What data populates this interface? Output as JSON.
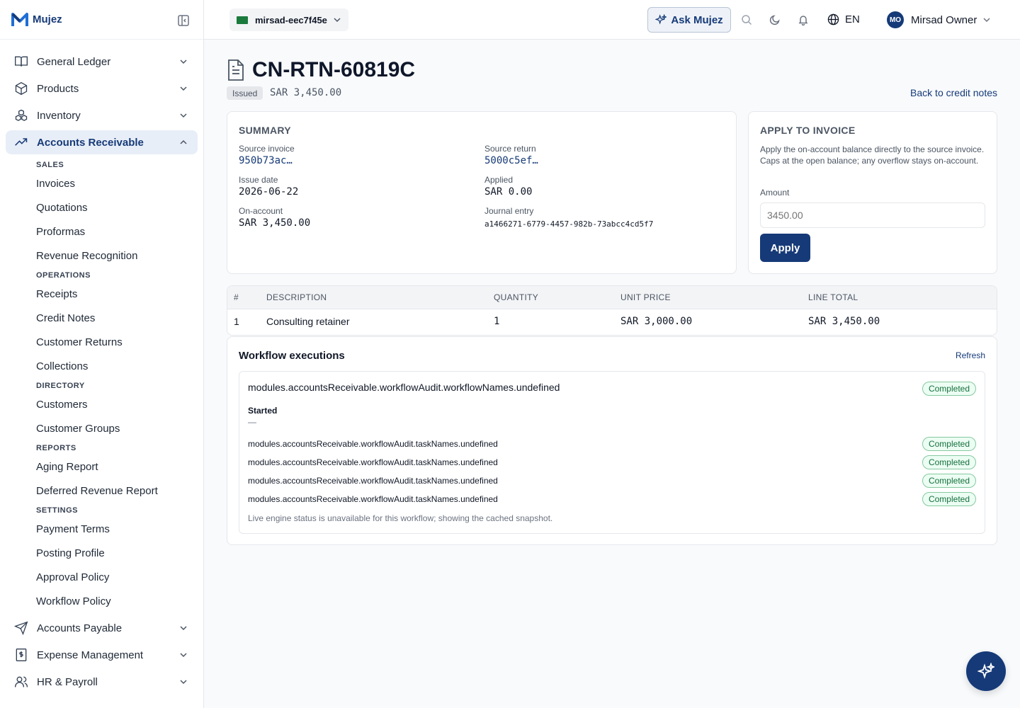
{
  "brand": {
    "name": "Mujez"
  },
  "colors": {
    "primary": "#163a78",
    "success": "#15703d"
  },
  "sidebar": {
    "items": [
      {
        "label": "General Ledger",
        "icon": "book-open-icon"
      },
      {
        "label": "Products",
        "icon": "box-icon"
      },
      {
        "label": "Inventory",
        "icon": "boxes-icon"
      },
      {
        "label": "Accounts Receivable",
        "icon": "trending-up-icon"
      },
      {
        "label": "Accounts Payable",
        "icon": "send-icon"
      },
      {
        "label": "Expense Management",
        "icon": "receipt-icon"
      },
      {
        "label": "HR & Payroll",
        "icon": "users-icon"
      }
    ],
    "ar_sections": [
      {
        "heading": "SALES",
        "items": [
          "Invoices",
          "Quotations",
          "Proformas",
          "Revenue Recognition"
        ]
      },
      {
        "heading": "OPERATIONS",
        "items": [
          "Receipts",
          "Credit Notes",
          "Customer Returns",
          "Collections"
        ]
      },
      {
        "heading": "DIRECTORY",
        "items": [
          "Customers",
          "Customer Groups"
        ]
      },
      {
        "heading": "REPORTS",
        "items": [
          "Aging Report",
          "Deferred Revenue Report"
        ]
      },
      {
        "heading": "SETTINGS",
        "items": [
          "Payment Terms",
          "Posting Profile",
          "Approval Policy",
          "Workflow Policy"
        ]
      }
    ]
  },
  "topbar": {
    "org": "mirsad-eec7f45e",
    "ask_label": "Ask Mujez",
    "language": "EN",
    "user_initials": "MO",
    "user_name": "Mirsad Owner"
  },
  "page": {
    "title": "CN-RTN-60819C",
    "status": "Issued",
    "amount": "SAR 3,450.00",
    "back_link": "Back to credit notes"
  },
  "summary": {
    "title": "SUMMARY",
    "source_invoice_label": "Source invoice",
    "source_invoice": "950b73ac…",
    "source_return_label": "Source return",
    "source_return": "5000c5ef…",
    "issue_date_label": "Issue date",
    "issue_date": "2026-06-22",
    "applied_label": "Applied",
    "applied": "SAR 0.00",
    "on_account_label": "On-account",
    "on_account": "SAR 3,450.00",
    "journal_label": "Journal entry",
    "journal": "a1466271-6779-4457-982b-73abcc4cd5f7"
  },
  "apply": {
    "title": "APPLY TO INVOICE",
    "description": "Apply the on-account balance directly to the source invoice. Caps at the open balance; any overflow stays on-account.",
    "amount_label": "Amount",
    "amount_placeholder": "3450.00",
    "button": "Apply"
  },
  "lines": {
    "headers": [
      "#",
      "DESCRIPTION",
      "QUANTITY",
      "UNIT PRICE",
      "LINE TOTAL"
    ],
    "rows": [
      [
        "1",
        "Consulting retainer",
        "1",
        "SAR 3,000.00",
        "SAR 3,450.00"
      ]
    ]
  },
  "workflow": {
    "title": "Workflow executions",
    "refresh": "Refresh",
    "name": "modules.accountsReceivable.workflowAudit.workflowNames.undefined",
    "status": "Completed",
    "started_label": "Started",
    "started_value": "—",
    "tasks": [
      {
        "name": "modules.accountsReceivable.workflowAudit.taskNames.undefined",
        "status": "Completed"
      },
      {
        "name": "modules.accountsReceivable.workflowAudit.taskNames.undefined",
        "status": "Completed"
      },
      {
        "name": "modules.accountsReceivable.workflowAudit.taskNames.undefined",
        "status": "Completed"
      },
      {
        "name": "modules.accountsReceivable.workflowAudit.taskNames.undefined",
        "status": "Completed"
      }
    ],
    "note": "Live engine status is unavailable for this workflow; showing the cached snapshot."
  }
}
